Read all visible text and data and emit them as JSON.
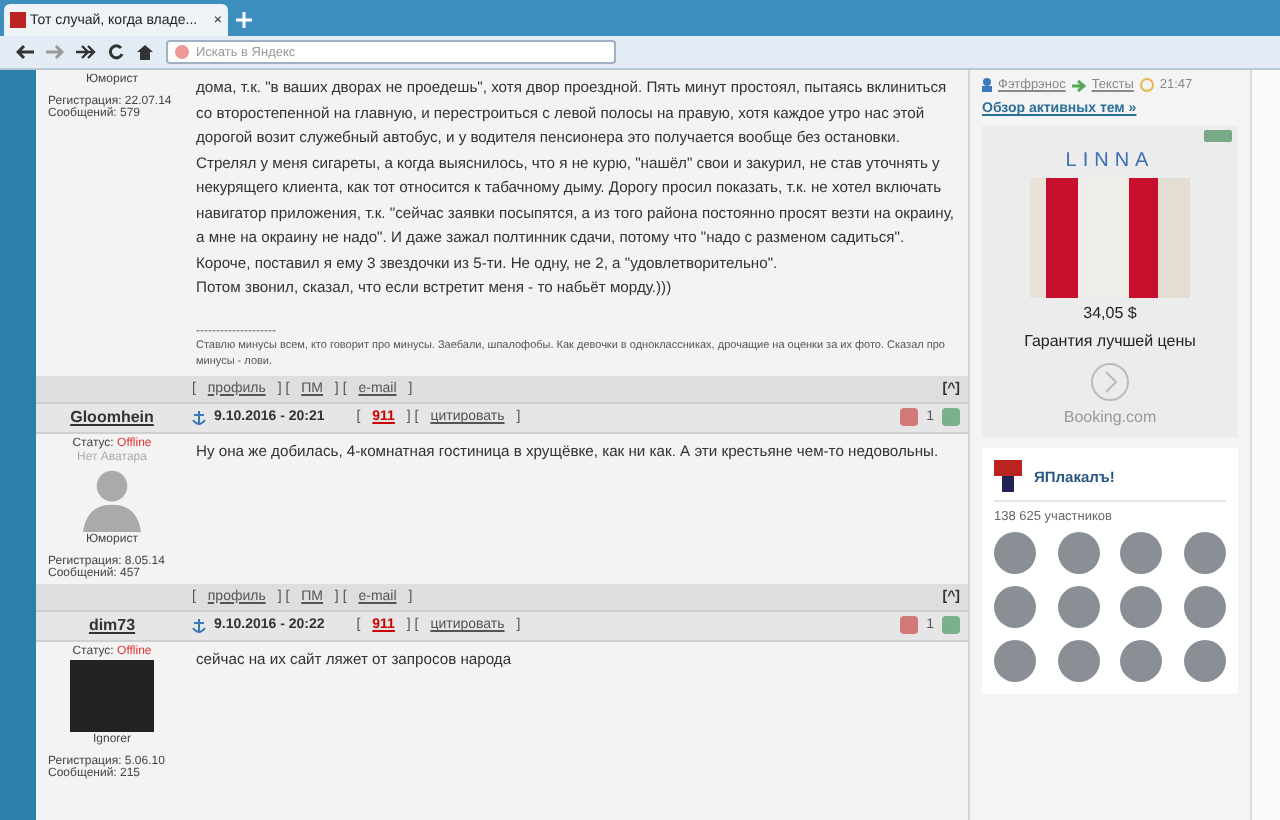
{
  "browser": {
    "tab_title": "Тот случай, когда владе...",
    "tab_close": "×",
    "address_placeholder": "Искать в Яндекс"
  },
  "posts": [
    {
      "rank": "Юморист",
      "registration": "Регистрация: 22.07.14",
      "messages": "Сообщений: 579",
      "paragraphs": [
        "дома, т.к. \"в ваших дворах не проедешь\", хотя двор проездной. Пять минут простоял, пытаясь вклиниться со второстепенной на главную, и перестроиться с левой полосы на правую, хотя каждое утро нас этой дорогой возит служебный автобус, и у водителя пенсионера это получается вообще без остановки. Стрелял у меня сигареты, а когда выяснилось, что я не курю, \"нашёл\" свои и закурил, не став уточнять у некурящего клиента, как тот относится к табачному дыму. Дорогу просил показать, т.к. не хотел включать навигатор приложения, т.к. \"сейчас заявки посыпятся, а из того района постоянно просят везти на окраину, а мне на окраину не надо\". И даже зажал полтинник сдачи, потому что \"надо с разменом садиться\".",
        "Короче, поставил я ему 3 звездочки из 5-ти. Не одну, не 2, а \"удовлетворительно\".",
        "Потом звонил, сказал, что если встретит меня - то набьёт морду.)))"
      ],
      "signature_rule": "--------------------",
      "signature": "Ставлю минусы всем, кто говорит про минусы. Заебали, шпалофобы. Как девочки в одноклассниках, дрочащие на оценки за их фото. Сказал про минусы - лови.",
      "footer": [
        {
          "kind": "text",
          "text": "[ "
        },
        {
          "kind": "link",
          "text": "профиль"
        },
        {
          "kind": "text",
          "text": " ] [ "
        },
        {
          "kind": "link",
          "text": "ПМ"
        },
        {
          "kind": "text",
          "text": " ] [ "
        },
        {
          "kind": "link",
          "text": "e-mail"
        },
        {
          "kind": "text",
          "text": " ]"
        }
      ],
      "top": "[^]"
    },
    {
      "author": "Gloomhein",
      "date": "9.10.2016 - 20:21",
      "meta": [
        {
          "kind": "text",
          "text": "[ "
        },
        {
          "kind": "alert",
          "text": "911"
        },
        {
          "kind": "text",
          "text": " ] [ "
        },
        {
          "kind": "link",
          "text": "цитировать"
        },
        {
          "kind": "text",
          "text": " ]"
        }
      ],
      "rating": "1",
      "status_label": "Статус:",
      "status": "Offline",
      "avatar": {
        "kind": "none",
        "caption": "Нет Аватара"
      },
      "rank": "Юморист",
      "registration": "Регистрация: 8.05.14",
      "messages": "Сообщений: 457",
      "paragraphs": [
        "Ну она же добилась, 4-комнатная гостиница в хрущёвке, как ни как. А эти крестьяне чем-то недовольны."
      ],
      "footer": [
        {
          "kind": "text",
          "text": "[ "
        },
        {
          "kind": "link",
          "text": "профиль"
        },
        {
          "kind": "text",
          "text": " ] [ "
        },
        {
          "kind": "link",
          "text": "ПМ"
        },
        {
          "kind": "text",
          "text": " ] [ "
        },
        {
          "kind": "link",
          "text": "e-mail"
        },
        {
          "kind": "text",
          "text": " ]"
        }
      ],
      "top": "[^]"
    },
    {
      "author": "dim73",
      "date": "9.10.2016 - 20:22",
      "meta": [
        {
          "kind": "text",
          "text": "[ "
        },
        {
          "kind": "alert",
          "text": "911"
        },
        {
          "kind": "text",
          "text": " ] [ "
        },
        {
          "kind": "link",
          "text": "цитировать"
        },
        {
          "kind": "text",
          "text": " ]"
        }
      ],
      "rating": "1",
      "status_label": "Статус:",
      "status": "Offline",
      "avatar": {
        "kind": "image"
      },
      "rank": "Ignorer",
      "registration": "Регистрация: 5.06.10",
      "messages": "Сообщений: 215",
      "paragraphs": [
        "сейчас на их сайт ляжет от запросов народа"
      ]
    }
  ],
  "sidebar": {
    "activity": {
      "user": "Фэтфрэнос",
      "section": "Тексты",
      "time": "21:47"
    },
    "overview_link": "Обзор активных тем »",
    "ad": {
      "brand": "LINNA",
      "price": "34,05 $",
      "caption": "Гарантия лучшей цены",
      "source": "Booking.com"
    },
    "community": {
      "name": "ЯПлакалъ!",
      "members": "138 625 участников"
    }
  }
}
